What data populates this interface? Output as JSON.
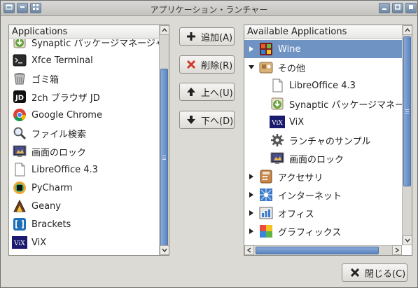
{
  "window": {
    "title": "アプリケーション・ランチャー",
    "controls": [
      "minimize",
      "maximize",
      "close"
    ]
  },
  "left_list": {
    "header": "Applications",
    "items": [
      {
        "label": "Synaptic パッケージマネージャ",
        "icon": "synaptic-icon"
      },
      {
        "label": "Xfce Terminal",
        "icon": "terminal-icon"
      },
      {
        "label": "ゴミ箱",
        "icon": "trash-icon"
      },
      {
        "label": "2ch ブラウザ JD",
        "icon": "jd-icon"
      },
      {
        "label": "Google Chrome",
        "icon": "chrome-icon"
      },
      {
        "label": "ファイル検索",
        "icon": "file-search-icon"
      },
      {
        "label": "画面のロック",
        "icon": "screen-lock-icon"
      },
      {
        "label": "LibreOffice 4.3",
        "icon": "document-icon"
      },
      {
        "label": "PyCharm",
        "icon": "pycharm-icon"
      },
      {
        "label": "Geany",
        "icon": "geany-icon"
      },
      {
        "label": "Brackets",
        "icon": "brackets-icon"
      },
      {
        "label": "ViX",
        "icon": "vix-icon"
      }
    ]
  },
  "buttons": {
    "add": "追加(A)",
    "remove": "削除(R)",
    "up": "上へ(U)",
    "down": "下へ(D)",
    "close": "閉じる(C)"
  },
  "right_list": {
    "header": "Available Applications",
    "items": [
      {
        "label": "Wine",
        "icon": "wine-icon",
        "expander": "collapsed",
        "selected": true
      },
      {
        "label": "その他",
        "icon": "other-icon",
        "expander": "expanded"
      },
      {
        "label": "LibreOffice 4.3",
        "icon": "document-icon",
        "child": true
      },
      {
        "label": "Synaptic パッケージマネージャ",
        "icon": "synaptic-icon",
        "child": true
      },
      {
        "label": "ViX",
        "icon": "vix-icon",
        "child": true
      },
      {
        "label": "ランチャのサンプル",
        "icon": "gear-icon",
        "child": true
      },
      {
        "label": "画面のロック",
        "icon": "screen-lock-icon",
        "child": true
      },
      {
        "label": "アクセサリ",
        "icon": "accessories-icon",
        "expander": "collapsed"
      },
      {
        "label": "インターネット",
        "icon": "internet-icon",
        "expander": "collapsed"
      },
      {
        "label": "オフィス",
        "icon": "office-icon",
        "expander": "collapsed"
      },
      {
        "label": "グラフィックス",
        "icon": "graphics-icon",
        "expander": "collapsed"
      }
    ]
  },
  "colors": {
    "selection": "#6f93c3",
    "scrollbar_thumb": "#5b85c1",
    "window_bg": "#dcdad5"
  }
}
